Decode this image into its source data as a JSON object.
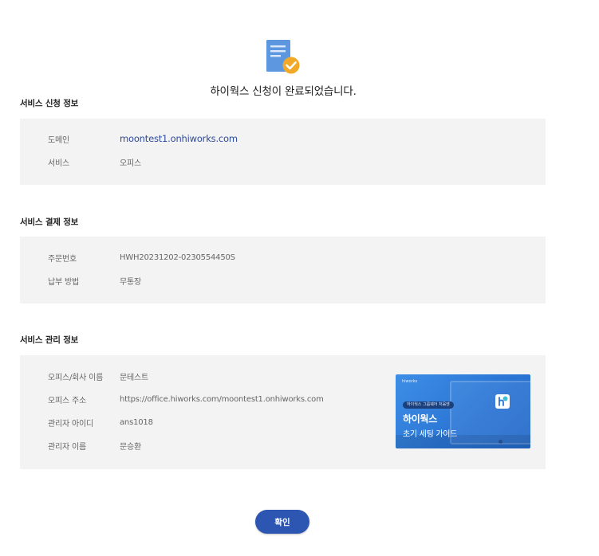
{
  "headline": "하이웍스 신청이 완료되었습니다.",
  "service_request": {
    "title": "서비스 신청 정보",
    "rows": [
      {
        "label": "도메인",
        "value": "moontest1.onhiworks.com"
      },
      {
        "label": "서비스",
        "value": "오피스"
      }
    ]
  },
  "payment": {
    "title": "서비스 결제 정보",
    "rows": [
      {
        "label": "주문번호",
        "value": "HWH20231202-0230554450S"
      },
      {
        "label": "납부 방법",
        "value": "무통장"
      }
    ]
  },
  "management": {
    "title": "서비스 관리 정보",
    "rows": [
      {
        "label": "오피스/회사 이름",
        "value": "문테스트"
      },
      {
        "label": "오피스 주소",
        "value": "https://office.hiworks.com/moontest1.onhiworks.com"
      },
      {
        "label": "관리자 아이디",
        "value": "ans1018"
      },
      {
        "label": "관리자 이름",
        "value": "문승환"
      }
    ]
  },
  "banner": {
    "brand": "hiworks",
    "pill": "하이웍스 그룹웨어 처음엔",
    "title": "하이웍스",
    "subtitle": "초기 세팅 가이드"
  },
  "confirm_label": "확인",
  "colors": {
    "accent": "#2d56b3",
    "link": "#2d4a9e",
    "box_bg": "#f3f3f3",
    "check": "#f2a928",
    "doc": "#4f8fde"
  },
  "icons": {
    "hero": "document-check-icon",
    "banner_badge": "hiworks-h-icon"
  }
}
